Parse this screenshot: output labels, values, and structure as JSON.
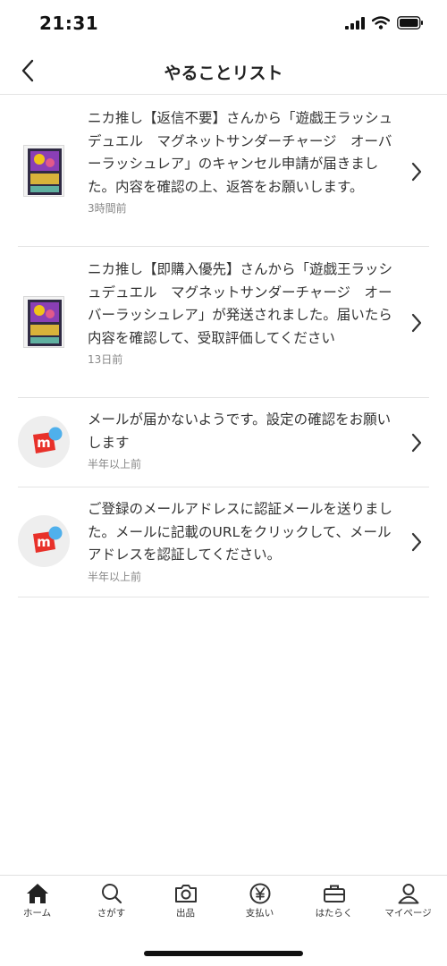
{
  "status": {
    "time": "21:31"
  },
  "header": {
    "title": "やることリスト"
  },
  "items": [
    {
      "message": "ニカ推し【返信不要】さんから「遊戯王ラッシュデュエル　マグネットサンダーチャージ　オーバーラッシュレア」のキャンセル申請が届きました。内容を確認の上、返答をお願いします。",
      "time": "3時間前",
      "avatar": "card-thumbnail"
    },
    {
      "message": "ニカ推し【即購入優先】さんから「遊戯王ラッシュデュエル　マグネットサンダーチャージ　オーバーラッシュレア」が発送されました。届いたら内容を確認して、受取評価してください",
      "time": "13日前",
      "avatar": "card-thumbnail"
    },
    {
      "message": "メールが届かないようです。設定の確認をお願いします",
      "time": "半年以上前",
      "avatar": "mercari-logo"
    },
    {
      "message": "ご登録のメールアドレスに認証メールを送りました。メールに記載のURLをクリックして、メールアドレスを認証してください。",
      "time": "半年以上前",
      "avatar": "mercari-logo"
    }
  ],
  "tabs": [
    {
      "label": "ホーム",
      "icon": "home-icon"
    },
    {
      "label": "さがす",
      "icon": "search-icon"
    },
    {
      "label": "出品",
      "icon": "camera-icon"
    },
    {
      "label": "支払い",
      "icon": "yen-icon"
    },
    {
      "label": "はたらく",
      "icon": "briefcase-icon"
    },
    {
      "label": "マイページ",
      "icon": "person-icon"
    }
  ],
  "colors": {
    "brand_red": "#e8312a",
    "badge_blue": "#4fb0ec",
    "divider": "#e4e4e4"
  }
}
